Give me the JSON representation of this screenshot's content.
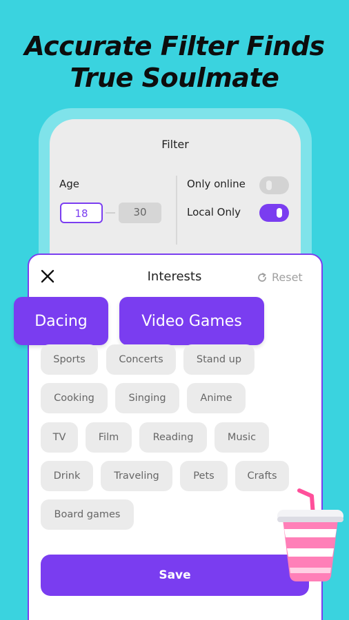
{
  "headline": {
    "line1": "Accurate Filter Finds",
    "line2": "True Soulmate"
  },
  "filter": {
    "title": "Filter",
    "age_label": "Age",
    "age_min": "18",
    "age_max": "30",
    "only_online_label": "Only online",
    "only_online_on": false,
    "local_only_label": "Local Only",
    "local_only_on": true
  },
  "interests": {
    "title": "Interests",
    "reset_label": "Reset",
    "highlighted": [
      "Dacing",
      "Video Games"
    ],
    "chips": [
      "Sports",
      "Concerts",
      "Stand up",
      "Cooking",
      "Singing",
      "Anime",
      "TV",
      "Film",
      "Reading",
      "Music",
      "Drink",
      "Traveling",
      "Pets",
      "Crafts",
      "Board games"
    ],
    "save_label": "Save"
  },
  "colors": {
    "background": "#3ad3df",
    "accent": "#7a3df0",
    "chip": "#ebebeb"
  },
  "icons": {
    "close": "close-icon",
    "reset": "refresh-icon",
    "decoration": "drink-cup-icon"
  }
}
